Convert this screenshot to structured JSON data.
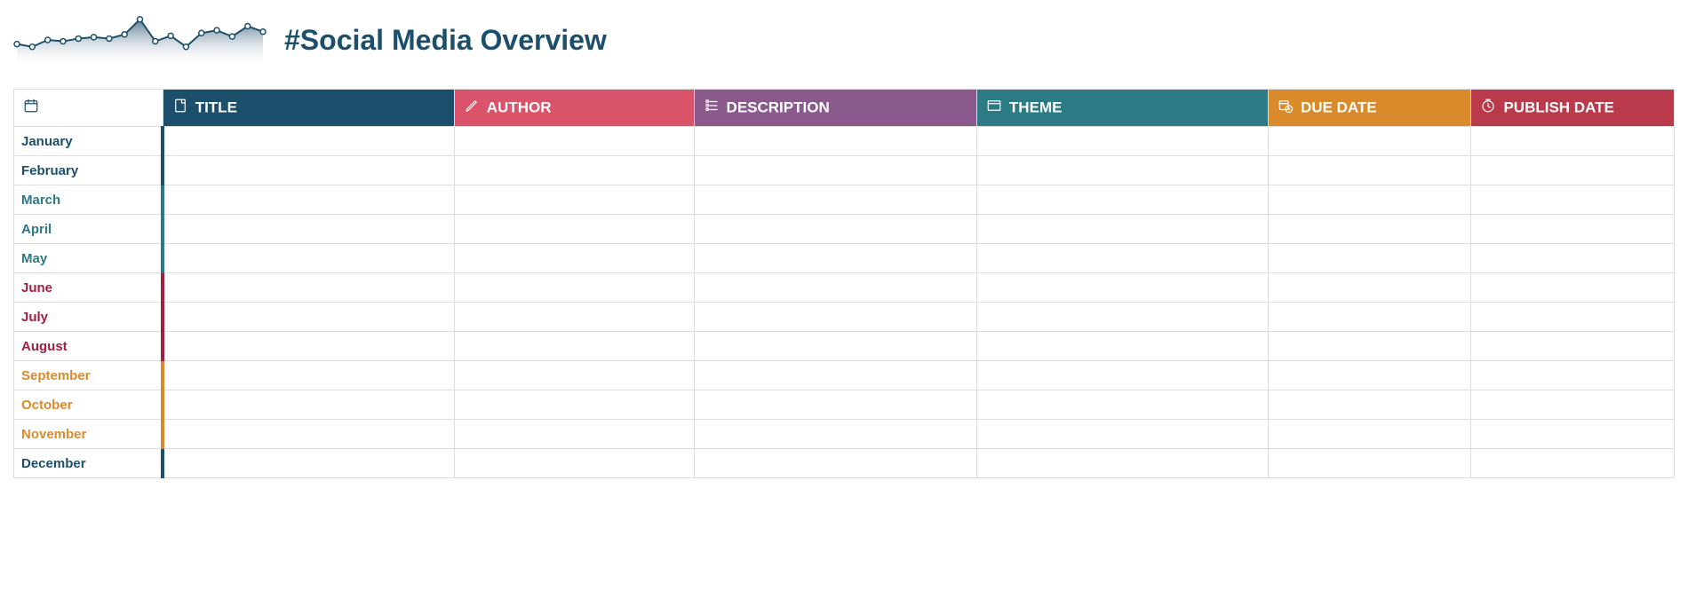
{
  "header": {
    "title": "#Social Media Overview"
  },
  "columns": [
    {
      "key": "month",
      "label": "MONTH",
      "bg": "#ffffff",
      "icon": "calendar-icon"
    },
    {
      "key": "title",
      "label": "TITLE",
      "bg": "#1b4f6b",
      "icon": "note-icon"
    },
    {
      "key": "author",
      "label": "AUTHOR",
      "bg": "#d9536b",
      "icon": "pencil-icon"
    },
    {
      "key": "description",
      "label": "DESCRIPTION",
      "bg": "#8a5a8c",
      "icon": "list-icon"
    },
    {
      "key": "theme",
      "label": "THEME",
      "bg": "#2b7a84",
      "icon": "window-icon"
    },
    {
      "key": "due_date",
      "label": "DUE DATE",
      "bg": "#d98b2b",
      "icon": "schedule-icon"
    },
    {
      "key": "publish_date",
      "label": "PUBLISH DATE",
      "bg": "#b83a4b",
      "icon": "clock-icon"
    }
  ],
  "rows": [
    {
      "month": "January",
      "color": "#1b4f6b",
      "title": "",
      "author": "",
      "description": "",
      "theme": "",
      "due_date": "",
      "publish_date": ""
    },
    {
      "month": "February",
      "color": "#1b4f6b",
      "title": "",
      "author": "",
      "description": "",
      "theme": "",
      "due_date": "",
      "publish_date": ""
    },
    {
      "month": "March",
      "color": "#2b7a84",
      "title": "",
      "author": "",
      "description": "",
      "theme": "",
      "due_date": "",
      "publish_date": ""
    },
    {
      "month": "April",
      "color": "#2b7a84",
      "title": "",
      "author": "",
      "description": "",
      "theme": "",
      "due_date": "",
      "publish_date": ""
    },
    {
      "month": "May",
      "color": "#2b7a84",
      "title": "",
      "author": "",
      "description": "",
      "theme": "",
      "due_date": "",
      "publish_date": ""
    },
    {
      "month": "June",
      "color": "#a02040",
      "title": "",
      "author": "",
      "description": "",
      "theme": "",
      "due_date": "",
      "publish_date": ""
    },
    {
      "month": "July",
      "color": "#a02040",
      "title": "",
      "author": "",
      "description": "",
      "theme": "",
      "due_date": "",
      "publish_date": ""
    },
    {
      "month": "August",
      "color": "#a02040",
      "title": "",
      "author": "",
      "description": "",
      "theme": "",
      "due_date": "",
      "publish_date": ""
    },
    {
      "month": "September",
      "color": "#d98b2b",
      "title": "",
      "author": "",
      "description": "",
      "theme": "",
      "due_date": "",
      "publish_date": ""
    },
    {
      "month": "October",
      "color": "#d98b2b",
      "title": "",
      "author": "",
      "description": "",
      "theme": "",
      "due_date": "",
      "publish_date": ""
    },
    {
      "month": "November",
      "color": "#d98b2b",
      "title": "",
      "author": "",
      "description": "",
      "theme": "",
      "due_date": "",
      "publish_date": ""
    },
    {
      "month": "December",
      "color": "#1b4f6b",
      "title": "",
      "author": "",
      "description": "",
      "theme": "",
      "due_date": "",
      "publish_date": ""
    }
  ],
  "chart_data": {
    "type": "line",
    "values": [
      34,
      30,
      40,
      38,
      42,
      44,
      42,
      48,
      70,
      38,
      46,
      30,
      50,
      54,
      45,
      60,
      52
    ],
    "ylim": [
      0,
      80
    ],
    "title": "",
    "xlabel": "",
    "ylabel": ""
  }
}
